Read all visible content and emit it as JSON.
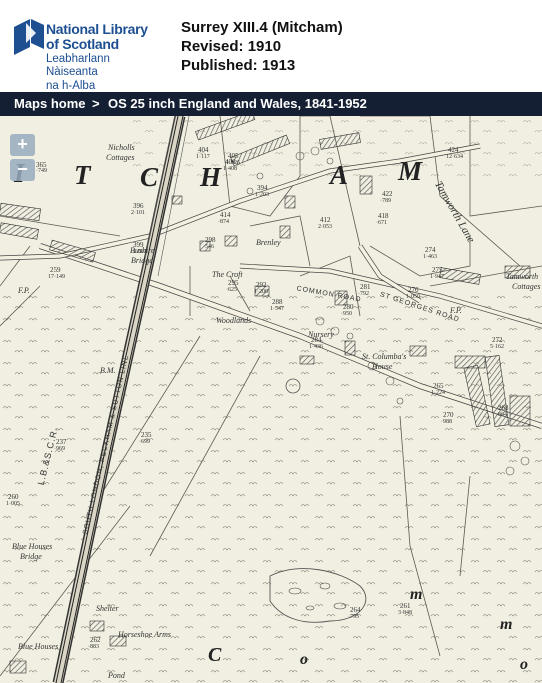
{
  "logo": {
    "line1": "National Library",
    "line2": "of Scotland",
    "gaelic1": "Leabharlann Nàiseanta",
    "gaelic2": "na h-Alba"
  },
  "sheet": {
    "title": "Surrey XIII.4 (Mitcham)",
    "revised": "Revised: 1910",
    "published": "Published: 1913"
  },
  "nav": {
    "home": "Maps home",
    "sep": ">",
    "series": "OS 25 inch England and Wales, 1841-1952"
  },
  "zoom": {
    "in": "+",
    "out": "−"
  },
  "map": {
    "town_letters": [
      "I",
      "T",
      "C",
      "H",
      "A",
      "M"
    ],
    "moor_letters": [
      "C",
      "o",
      "m",
      "m",
      "o"
    ],
    "places": {
      "nicholls": "Nicholls",
      "cottages": "Cottages",
      "bushire": "Bushire",
      "bridge": "Bridge",
      "croft": "The Croft",
      "brenley": "Brenley",
      "woodlands": "Woodlands",
      "nursery": "Nursery",
      "st_columbas": "St. Columba's",
      "house": "House",
      "tamworth": "Tamworth",
      "tam_cottages": "Cottages",
      "blue_houses_bridge": "Blue Houses",
      "bh_bridge": "Bridge",
      "blue_houses": "Blue Houses",
      "shelter": "Shelter",
      "horseshoe_arms": "Horseshoe Arms",
      "pond": "Pond",
      "fp1": "F.P.",
      "fp2": "F.P.",
      "bm": "B.M."
    },
    "railway": {
      "line1": "L.B.&S.C.R.",
      "line2": "SOUTH LONDON, PECKHAM & SUTTON LINE"
    },
    "roads": {
      "common_road": "COMMON ROAD",
      "st_georges": "ST GEORGES ROAD",
      "tamworth_lane": "Tamworth Lane"
    },
    "parcels": [
      "396",
      "2·101",
      "399",
      "1·002",
      "394",
      "1·203",
      "404",
      "1·117",
      "405",
      "1·926",
      "406",
      "1·408",
      "412",
      "2·053",
      "418",
      "·671",
      "424",
      "12·634",
      "274",
      "1·463",
      "275",
      "1·947",
      "276",
      "1·050",
      "298",
      "·546",
      "295",
      "·625",
      "292",
      "1·200",
      "288",
      "1·347",
      "284",
      "1·436",
      "281",
      "·792",
      "280",
      "·950",
      "265",
      "1·224",
      "272",
      "5·162",
      "270",
      "·988",
      "268",
      "·864",
      "259",
      "17·149",
      "237",
      "·969",
      "235",
      "·699",
      "260",
      "1·005",
      "264",
      "·795",
      "261",
      "3·848",
      "262",
      "·883",
      "365",
      "·749",
      "414",
      "·874",
      "422",
      "·789"
    ]
  }
}
